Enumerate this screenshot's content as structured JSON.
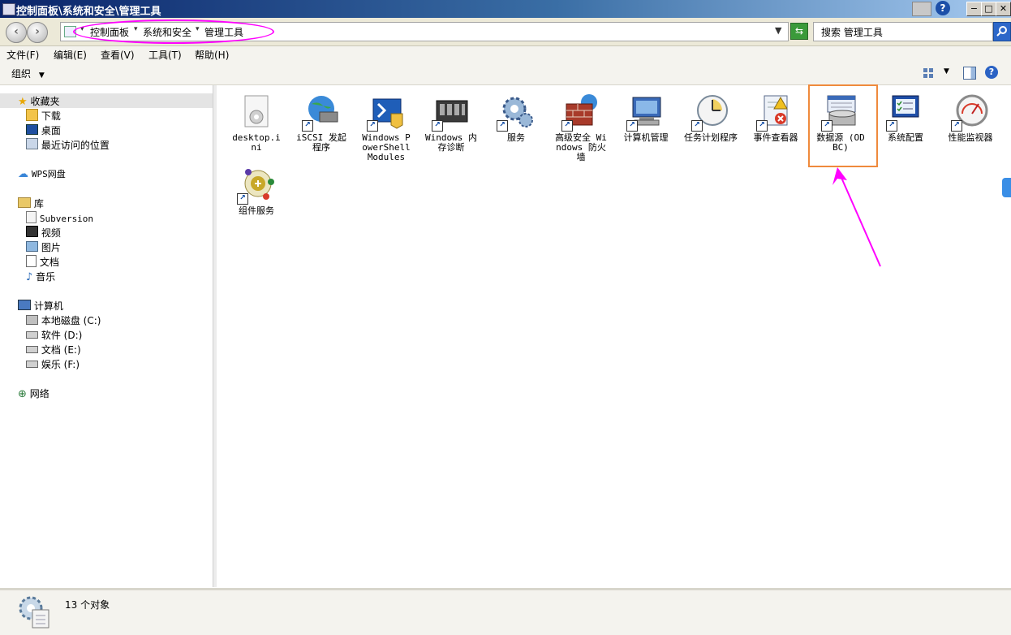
{
  "window": {
    "title": "控制面板\\系统和安全\\管理工具",
    "buttons": [
      "?",
      "−",
      "□",
      "✕"
    ]
  },
  "address": {
    "crumbs": [
      "控制面板",
      "系统和安全",
      "管理工具"
    ],
    "search_placeholder": "搜索 管理工具"
  },
  "menu": [
    "文件(F)",
    "编辑(E)",
    "查看(V)",
    "工具(T)",
    "帮助(H)"
  ],
  "toolbar": {
    "organize": "组织"
  },
  "nav": {
    "favorites": "收藏夹",
    "downloads": "下载",
    "desktop": "桌面",
    "recent": "最近访问的位置",
    "wps": "WPS网盘",
    "library": "库",
    "subversion": "Subversion",
    "videos": "视频",
    "pictures": "图片",
    "documents": "文档",
    "music": "音乐",
    "computer": "计算机",
    "drive_c": "本地磁盘 (C:)",
    "drive_d": "软件 (D:)",
    "drive_e": "文档 (E:)",
    "drive_f": "娱乐 (F:)",
    "network": "网络"
  },
  "files": [
    "desktop.ini",
    "iSCSI 发起程序",
    "Windows PowerShell Modules",
    "Windows 内存诊断",
    "服务",
    "高级安全 Windows 防火墙",
    "计算机管理",
    "任务计划程序",
    "事件查看器",
    "数据源 (ODBC)",
    "系统配置",
    "性能监视器",
    "组件服务"
  ],
  "status": {
    "count": "13 个对象"
  },
  "colors": {
    "highlight": "#ef8a3c",
    "annotation": "#ff00ff"
  }
}
